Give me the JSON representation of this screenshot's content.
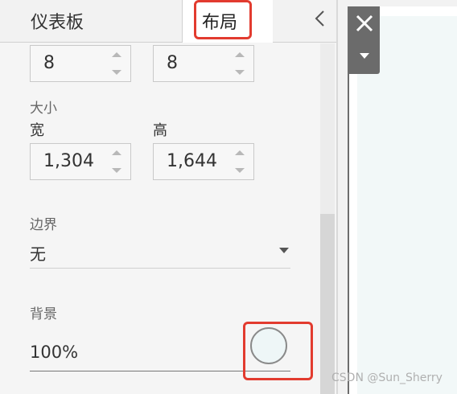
{
  "tabs": {
    "dashboard": "仪表板",
    "layout": "布局"
  },
  "position": {
    "x": "8",
    "y": "8"
  },
  "size": {
    "section_label": "大小",
    "width_label": "宽",
    "height_label": "高",
    "width_value": "1,304",
    "height_value": "1,644"
  },
  "border": {
    "label": "边界",
    "value": "无"
  },
  "background": {
    "label": "背景",
    "opacity": "100%",
    "swatch_color": "#eef6f7"
  },
  "highlight_color": "#e23b2f",
  "watermark": "CSDN @Sun_Sherry",
  "icons": [
    "chevron-left-icon",
    "close-icon",
    "dropdown-icon",
    "spin-up-icon",
    "spin-down-icon"
  ]
}
